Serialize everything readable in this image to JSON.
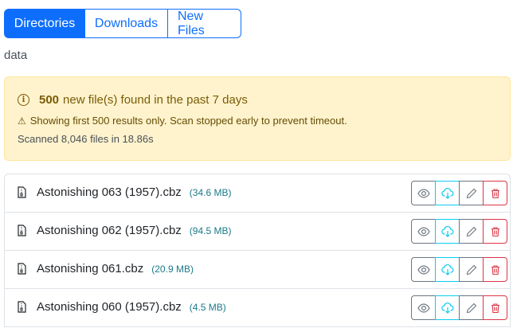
{
  "tabs": [
    {
      "label": "Directories",
      "active": true
    },
    {
      "label": "Downloads",
      "active": false
    },
    {
      "label": "New Files",
      "active": false
    }
  ],
  "path": "data",
  "alert": {
    "count": "500",
    "headline": "new file(s) found in the past 7 days",
    "warning": "Showing first 500 results only. Scan stopped early to prevent timeout.",
    "scan_summary": "Scanned 8,046 files in 18.86s"
  },
  "files": [
    {
      "name": "Astonishing 063 (1957).cbz",
      "size": "(34.6 MB)"
    },
    {
      "name": "Astonishing 062 (1957).cbz",
      "size": "(94.5 MB)"
    },
    {
      "name": "Astonishing 061.cbz",
      "size": "(20.9 MB)"
    },
    {
      "name": "Astonishing 060 (1957).cbz",
      "size": "(4.5 MB)"
    }
  ],
  "icons": {
    "file": "file-zip-icon",
    "view": "eye-icon",
    "download": "cloud-download-icon",
    "edit": "pencil-icon",
    "delete": "trash-icon"
  },
  "colors": {
    "primary": "#0d6efd",
    "warning_bg": "#fff3cd",
    "warning_text": "#664d03",
    "info_button": "#0dcaf0",
    "danger": "#dc3545",
    "secondary": "#6c757d",
    "size_text": "#1a7a8a"
  }
}
